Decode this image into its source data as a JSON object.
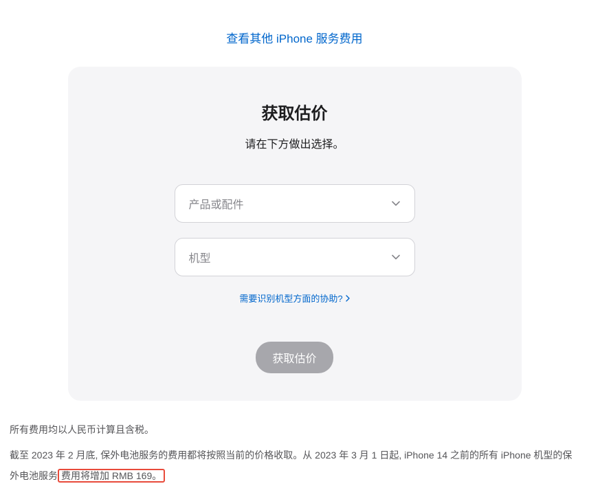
{
  "top_link": {
    "label": "查看其他 iPhone 服务费用"
  },
  "card": {
    "title": "获取估价",
    "subtitle": "请在下方做出选择。",
    "select_product_placeholder": "产品或配件",
    "select_model_placeholder": "机型",
    "help_link_label": "需要识别机型方面的协助?",
    "submit_label": "获取估价"
  },
  "disclaimer": {
    "line1": "所有费用均以人民币计算且含税。",
    "line2_before": "截至 2023 年 2 月底, 保外电池服务的费用都将按照当前的价格收取。从 2023 年 3 月 1 日起, iPhone 14 之前的所有 iPhone 机型的保外电池服务",
    "line2_highlight": "费用将增加 RMB 169。"
  }
}
